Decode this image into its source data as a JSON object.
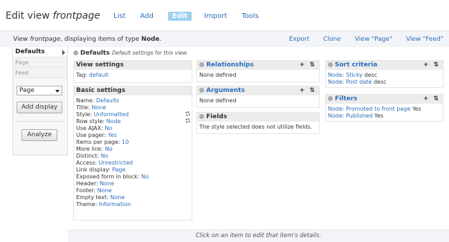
{
  "header": {
    "title_prefix": "Edit view ",
    "title_view": "frontpage",
    "tabs": [
      "List",
      "Add",
      "Edit",
      "Import",
      "Tools"
    ]
  },
  "infobar": {
    "text_prefix": "View ",
    "view_name": "frontpage",
    "text_middle": ", displaying items of type ",
    "type": "Node",
    "text_suffix": ".",
    "links": [
      "Export",
      "Clone",
      "View \"Page\"",
      "View \"Feed\""
    ]
  },
  "sidebar": {
    "displays": [
      "Defaults",
      "Page",
      "Feed"
    ],
    "select_value": "Page",
    "add_display_label": "Add display",
    "analyze_label": "Analyze"
  },
  "main": {
    "head_title": "Defaults",
    "head_note": "Default settings for this view."
  },
  "view_settings": {
    "title": "View settings",
    "tag_label": "Tag: ",
    "tag_value": "default"
  },
  "basic_settings": {
    "title": "Basic settings",
    "rows": [
      {
        "label": "Name: ",
        "value": "Defaults"
      },
      {
        "label": "Title: ",
        "value": "None"
      },
      {
        "label": "Style: ",
        "value": "Unformatted"
      },
      {
        "label": "Row style: ",
        "value": "Node"
      },
      {
        "label": "Use AJAX: ",
        "value": "No"
      },
      {
        "label": "Use pager: ",
        "value": "Yes"
      },
      {
        "label": "Items per page: ",
        "value": "10"
      },
      {
        "label": "More link: ",
        "value": "No"
      },
      {
        "label": "Distinct: ",
        "value": "No"
      },
      {
        "label": "Access: ",
        "value": "Unrestricted"
      },
      {
        "label": "Link display: ",
        "value": "Page"
      },
      {
        "label": "Exposed form in block: ",
        "value": "No"
      },
      {
        "label": "Header: ",
        "value": "None"
      },
      {
        "label": "Footer: ",
        "value": "None"
      },
      {
        "label": "Empty text: ",
        "value": "None"
      },
      {
        "label": "Theme: ",
        "value": "Information"
      }
    ]
  },
  "relationships": {
    "title": "Relationships",
    "body": "None defined",
    "controls": "+ ⇅"
  },
  "arguments": {
    "title": "Arguments",
    "body": "None defined",
    "controls": "+ ⇅"
  },
  "fields": {
    "title": "Fields",
    "body": "The style selected does not utilize fields."
  },
  "sort_criteria": {
    "title": "Sort criteria",
    "controls": "+ ⇅",
    "rows": [
      {
        "label": "Node: Sticky",
        "value": " desc"
      },
      {
        "label": "Node: Post date",
        "value": " desc"
      }
    ]
  },
  "filters": {
    "title": "Filters",
    "controls": "+ ⇅",
    "rows": [
      {
        "label": "Node: Promoted to front page",
        "value": " Yes"
      },
      {
        "label": "Node: Published",
        "value": " Yes"
      }
    ]
  },
  "footer": {
    "text": "Click on an item to edit that item's details."
  }
}
